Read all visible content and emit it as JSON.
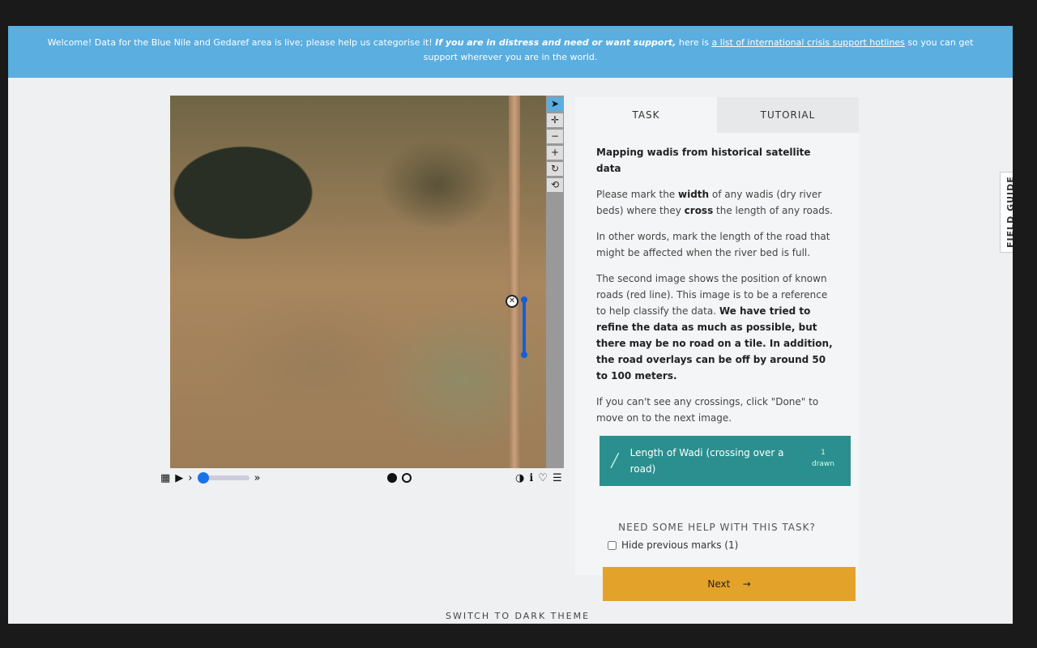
{
  "banner": {
    "text1": "Welcome! Data for the Blue Nile and Gedaref area is live; please help us categorise it! ",
    "distress": "If you are in distress and need or want support,",
    "text2": " here is ",
    "link": "a list of international crisis support hotlines",
    "text3": " so you can get support wherever you are in the world."
  },
  "tabs": {
    "task": "TASK",
    "tutorial": "TUTORIAL"
  },
  "task": {
    "heading": "Mapping wadis from historical satellite data",
    "p1a": "Please mark the ",
    "p1b": "width",
    "p1c": " of any wadis (dry river beds) where they ",
    "p1d": "cross",
    "p1e": " the length of any roads.",
    "p2": "In other words, mark the length of the road that might be affected when the river bed is full.",
    "p3a": "The second image shows the position of known roads (red line). This image is to be a reference to help classify the data. ",
    "p3b": "We have tried to refine the data as much as possible, but there may be no road on a tile. In addition, the road overlays can be off by around 50 to 100 meters.",
    "p4": "If you can't see any crossings, click \"Done\" to move on to the next image.",
    "tool_label": "Length of Wadi (crossing over a road)",
    "tool_count": "1",
    "tool_count_label": "drawn",
    "help": "NEED SOME HELP WITH THIS TASK?",
    "hide_marks": "Hide previous marks (1)",
    "next": "Next",
    "next_arrow": "→"
  },
  "field_guide": "FIELD GUIDE",
  "dark_theme": "SWITCH TO DARK THEME",
  "icons": {
    "pointer": "➤",
    "move": "✛",
    "zoom_out": "−",
    "zoom_in": "+",
    "rotate": "↻",
    "reset": "⟲",
    "grid": "▦",
    "play": "▶",
    "prev": "›",
    "next_frames": "»",
    "contrast": "◑",
    "info": "ℹ",
    "heart": "♡",
    "list": "☰",
    "delete": "✕",
    "pencil": "╱"
  }
}
